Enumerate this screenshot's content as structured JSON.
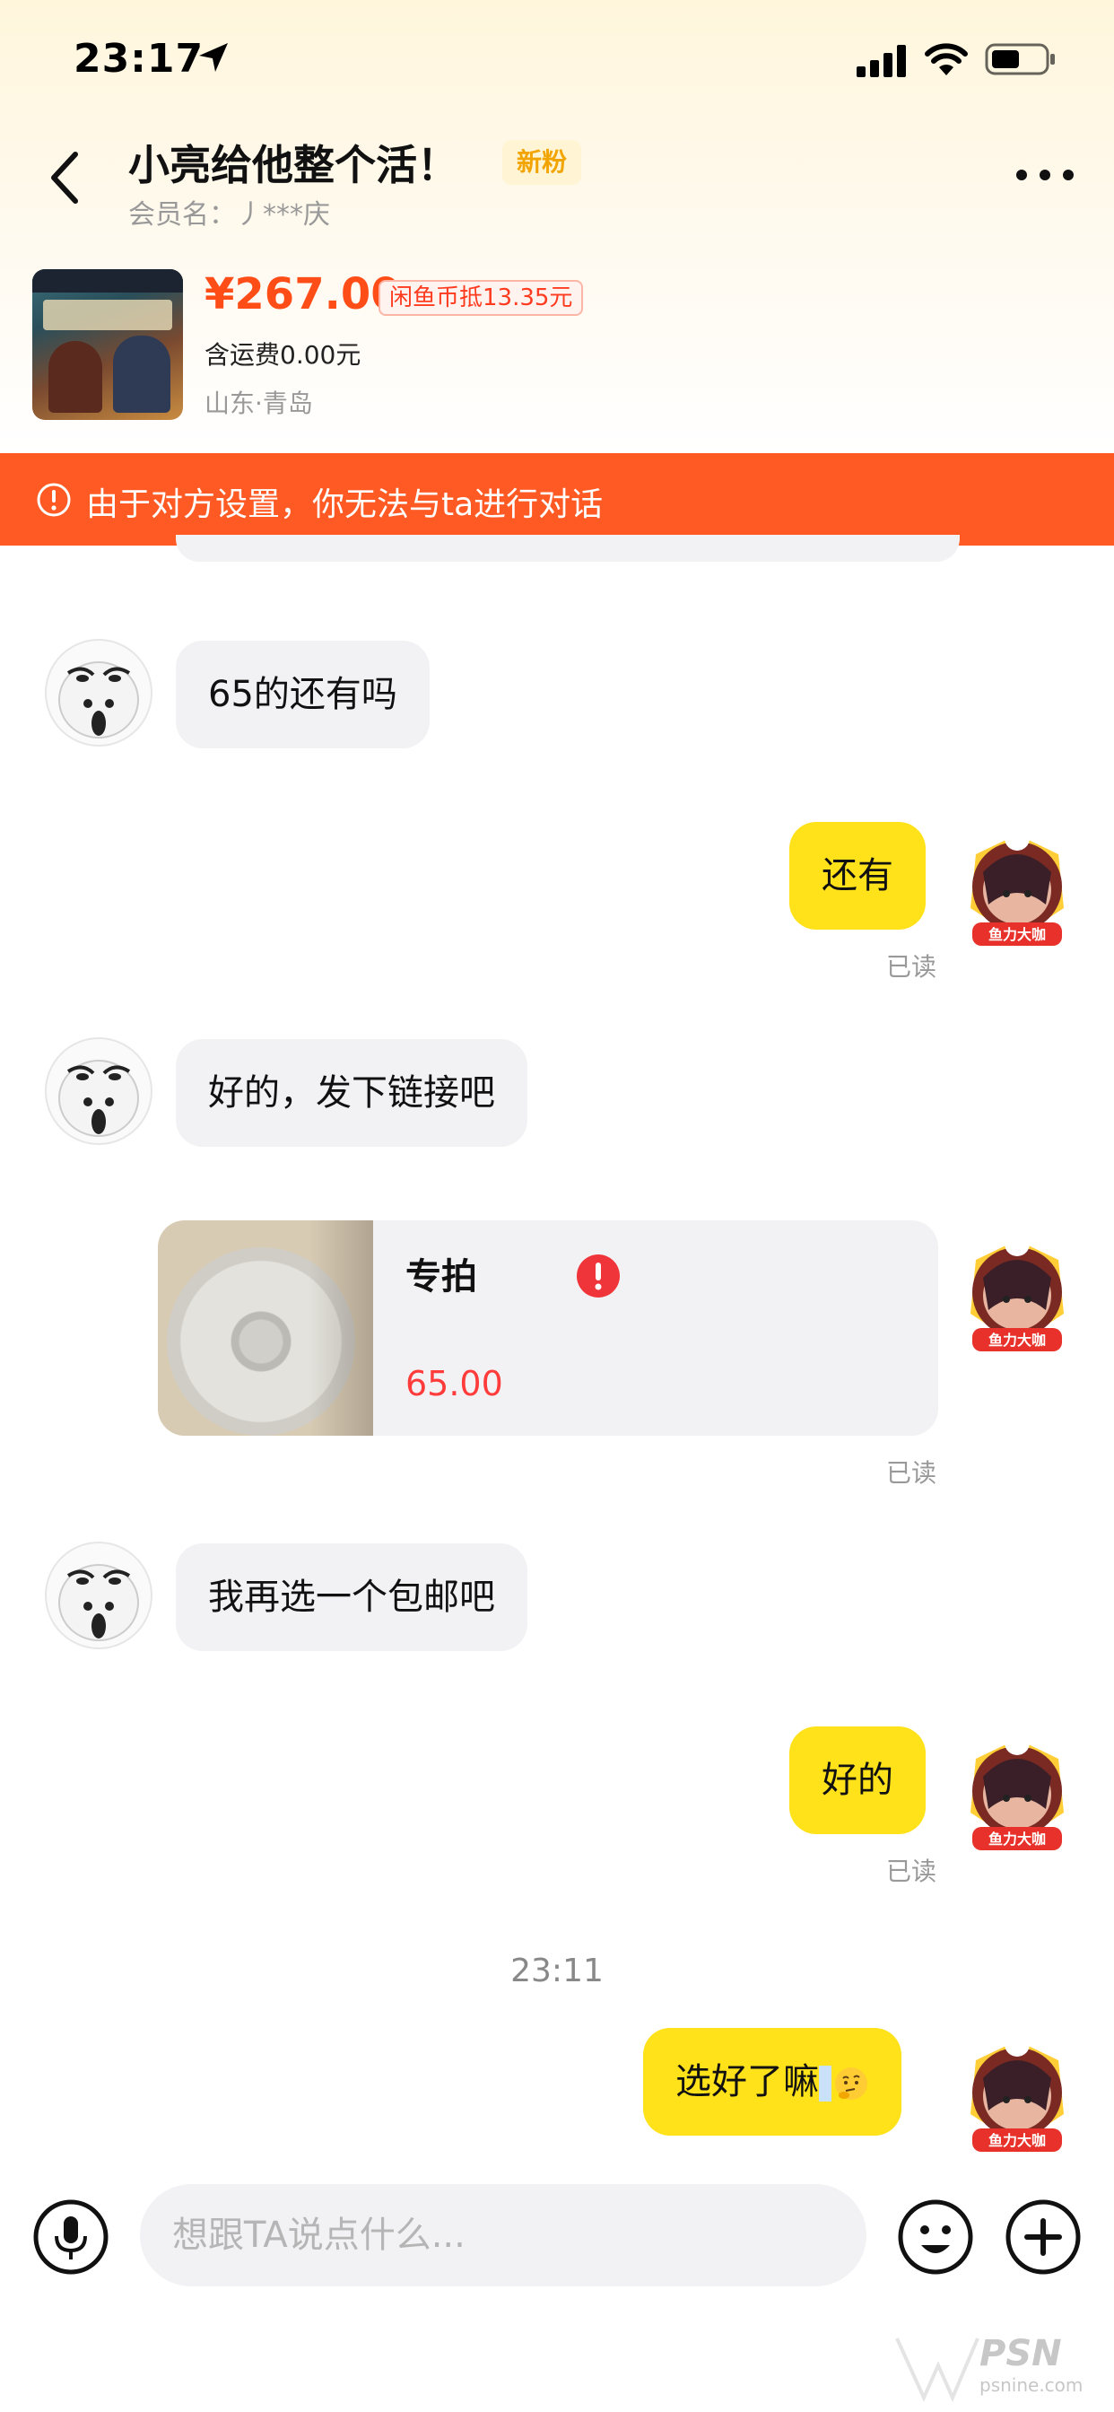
{
  "status_bar": {
    "time": "23:17"
  },
  "header": {
    "title": "小亮给他整个活！",
    "fan_badge": "新粉",
    "member_name": "会员名：丿***庆"
  },
  "product": {
    "price": "¥267.00",
    "coin_discount": "闲鱼币抵13.35元",
    "shipping": "含运费0.00元",
    "location": "山东·青岛"
  },
  "warning": {
    "text": "由于对方设置，你无法与ta进行对话"
  },
  "messages": [
    {
      "sender": "other",
      "text": "65的还有吗"
    },
    {
      "sender": "self",
      "text": "还有",
      "status": "已读"
    },
    {
      "sender": "other",
      "text": "好的，发下链接吧"
    },
    {
      "sender": "self",
      "type": "link",
      "title": "专拍",
      "price": "65.00",
      "status": "已读"
    },
    {
      "sender": "other",
      "text": "我再选一个包邮吧"
    },
    {
      "sender": "self",
      "text": "好的",
      "status": "已读"
    },
    {
      "type": "timestamp",
      "text": "23:11"
    },
    {
      "sender": "self",
      "text": "选好了嘛",
      "emoji": "thinking-face",
      "failed": true
    }
  ],
  "self_avatar_badge": "鱼力大咖",
  "input": {
    "placeholder": "想跟TA说点什么..."
  },
  "watermark": {
    "text": "PSN",
    "sub": "psnine.com"
  },
  "colors": {
    "accent_yellow": "#ffe21a",
    "warning_orange": "#ff5a23",
    "price_red": "#ff4d18",
    "badge_gold": "#f2a400"
  }
}
